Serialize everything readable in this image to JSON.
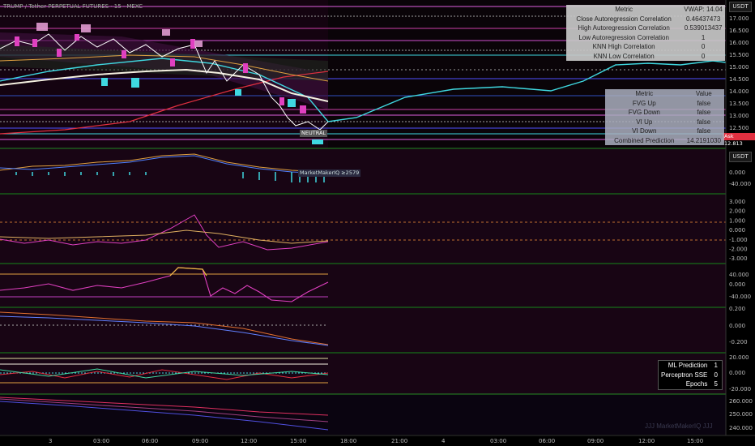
{
  "header": {
    "symbol_title": "TRUMP / Tether PERPETUAL FUTURES · 15 · MEXC",
    "currency_label": "USDT"
  },
  "price_axis": {
    "labels": [
      "17.000",
      "16.500",
      "16.000",
      "15.500",
      "15.000",
      "14.500",
      "14.000",
      "13.500",
      "13.000",
      "12.500"
    ]
  },
  "price_tags": {
    "ask": "Ask 12.813",
    "neutral": "NEUTRAL"
  },
  "osc1_axis": {
    "currency_label": "USDT",
    "labels": [
      "0.000",
      "-40.000"
    ]
  },
  "osc1_tag": "MarketMakerIQ ≥2579",
  "osc2_axis": {
    "labels": [
      "3.000",
      "2.000",
      "1.000",
      "0.000",
      "-1.000",
      "-2.000",
      "-3.000"
    ]
  },
  "osc3_axis": {
    "labels": [
      "40.000",
      "0.000",
      "-40.000"
    ]
  },
  "osc4_axis": {
    "labels": [
      "0.200",
      "0.000",
      "-0.200"
    ]
  },
  "osc5_axis": {
    "labels": [
      "20.000",
      "0.000",
      "-20.000"
    ]
  },
  "osc6_axis": {
    "labels": [
      "260.000",
      "250.000",
      "240.000"
    ]
  },
  "time_axis": {
    "labels": [
      "3",
      "03:00",
      "06:00",
      "09:00",
      "12:00",
      "15:00",
      "18:00",
      "21:00",
      "4",
      "03:00",
      "06:00",
      "09:00",
      "12:00",
      "15:00"
    ]
  },
  "metrics_table_top": {
    "header": {
      "metric": "Metric",
      "value": "VWAP: 14.04"
    },
    "rows": [
      {
        "metric": "Close Autoregression Correlation",
        "value": "0.46437473"
      },
      {
        "metric": "High Autoregression Correlation",
        "value": "0.539013437"
      },
      {
        "metric": "Low Autoregression Correlation",
        "value": "1"
      },
      {
        "metric": "KNN High Correlation",
        "value": "0"
      },
      {
        "metric": "KNN Low Correlation",
        "value": "0"
      }
    ]
  },
  "metrics_table_mid": {
    "header": {
      "metric": "Metric",
      "value": "Value"
    },
    "rows": [
      {
        "metric": "FVG Up",
        "value": "false"
      },
      {
        "metric": "FVG Down",
        "value": "false"
      },
      {
        "metric": "VI Up",
        "value": "false"
      },
      {
        "metric": "VI Down",
        "value": "false"
      },
      {
        "metric": "Combined Prediction",
        "value": "14.2191030"
      }
    ]
  },
  "ml_table": {
    "rows": [
      {
        "metric": "ML Prediction",
        "value": "1"
      },
      {
        "metric": "Perceptron SSE",
        "value": "0"
      },
      {
        "metric": "Epochs",
        "value": "5"
      }
    ]
  },
  "signature": "JJJ MarketMakerIQ JJJ",
  "colors": {
    "background": "#000000",
    "pane_background": "#1a0614",
    "pane_border": "#2e8b2e",
    "cyan": "#3fd8e0",
    "magenta": "#e040c0",
    "red": "#e03040",
    "white": "#f4f0e0",
    "orange": "#e0a040"
  }
}
